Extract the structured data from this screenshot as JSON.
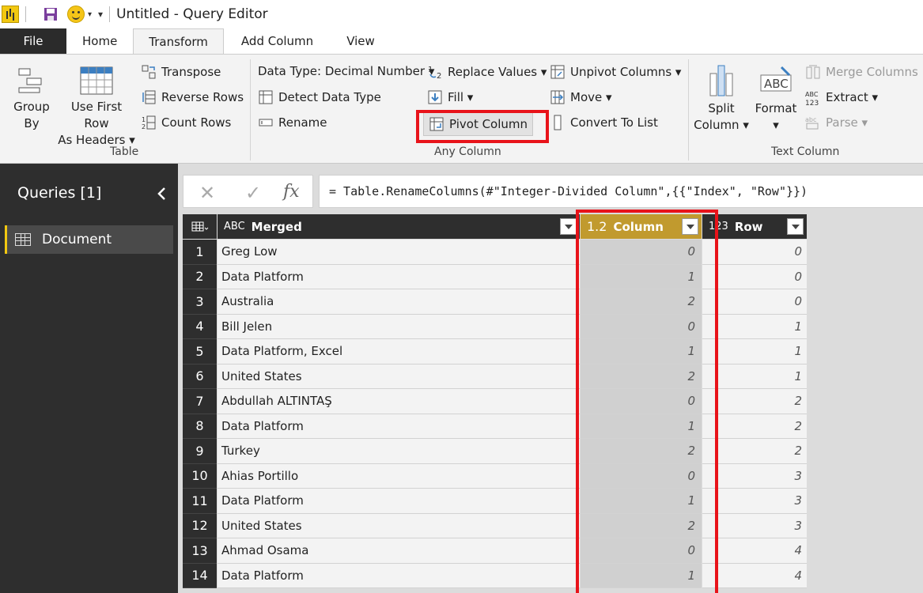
{
  "window": {
    "title": "Untitled - Query Editor"
  },
  "tabs": [
    {
      "label": "File"
    },
    {
      "label": "Home"
    },
    {
      "label": "Transform"
    },
    {
      "label": "Add Column"
    },
    {
      "label": "View"
    }
  ],
  "ribbon": {
    "table_group": {
      "label": "Table",
      "group_by": [
        "Group",
        "By"
      ],
      "use_first_row": [
        "Use First Row",
        "As Headers ▾"
      ],
      "transpose": "Transpose",
      "reverse_rows": "Reverse Rows",
      "count_rows": "Count Rows"
    },
    "any_column_group": {
      "label": "Any Column",
      "data_type": "Data Type: Decimal Number ▾",
      "detect_data_type": "Detect Data Type",
      "rename": "Rename",
      "replace_values": "Replace Values ▾",
      "fill": "Fill ▾",
      "pivot_column": "Pivot Column",
      "unpivot_columns": "Unpivot Columns ▾",
      "move": "Move ▾",
      "convert_to_list": "Convert To List"
    },
    "text_column_group": {
      "label": "Text Column",
      "split_column": [
        "Split",
        "Column ▾"
      ],
      "format": [
        "Format",
        "▾"
      ],
      "merge_columns": "Merge Columns",
      "extract": "Extract ▾",
      "parse": "Parse ▾"
    }
  },
  "queries": {
    "title": "Queries [1]",
    "items": [
      {
        "label": "Document"
      }
    ]
  },
  "formula_bar": {
    "cancel": "✕",
    "commit": "✓",
    "fx": "fx",
    "formula": "= Table.RenameColumns(#\"Integer-Divided Column\",{{\"Index\", \"Row\"}})"
  },
  "grid": {
    "columns": [
      {
        "type": "ABC",
        "name": "Merged"
      },
      {
        "type": "1.2",
        "name": "Column"
      },
      {
        "type": "123",
        "name": "Row"
      }
    ],
    "rows": [
      {
        "idx": "1",
        "merged": "Greg  Low",
        "column": "0",
        "row": "0"
      },
      {
        "idx": "2",
        "merged": "Data Platform",
        "column": "1",
        "row": "0"
      },
      {
        "idx": "3",
        "merged": "Australia",
        "column": "2",
        "row": "0"
      },
      {
        "idx": "4",
        "merged": "Bill  Jelen",
        "column": "0",
        "row": "1"
      },
      {
        "idx": "5",
        "merged": "Data Platform, Excel",
        "column": "1",
        "row": "1"
      },
      {
        "idx": "6",
        "merged": "United States",
        "column": "2",
        "row": "1"
      },
      {
        "idx": "7",
        "merged": "Abdullah  ALTINTAŞ",
        "column": "0",
        "row": "2"
      },
      {
        "idx": "8",
        "merged": "Data Platform",
        "column": "1",
        "row": "2"
      },
      {
        "idx": "9",
        "merged": "Turkey",
        "column": "2",
        "row": "2"
      },
      {
        "idx": "10",
        "merged": "Ahias  Portillo",
        "column": "0",
        "row": "3"
      },
      {
        "idx": "11",
        "merged": "Data Platform",
        "column": "1",
        "row": "3"
      },
      {
        "idx": "12",
        "merged": "United States",
        "column": "2",
        "row": "3"
      },
      {
        "idx": "13",
        "merged": "Ahmad  Osama",
        "column": "0",
        "row": "4"
      },
      {
        "idx": "14",
        "merged": "Data Platform",
        "column": "1",
        "row": "4"
      }
    ]
  },
  "colors": {
    "accent": "#f2c811",
    "selected_header": "#c19a2e",
    "highlight_box": "#e8131a",
    "dark_panel": "#2e2e2e"
  }
}
